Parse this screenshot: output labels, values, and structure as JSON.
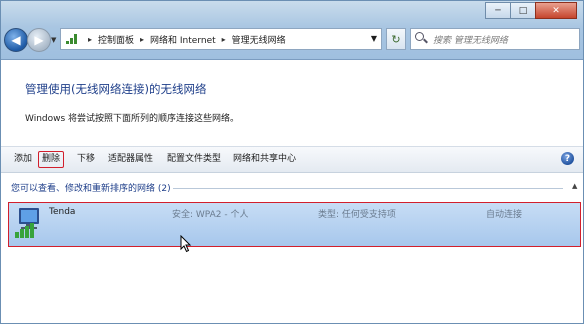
{
  "window": {
    "caption_minimize": "─",
    "caption_maximize": "□",
    "caption_close": "✕"
  },
  "nav": {
    "back_glyph": "◀",
    "forward_glyph": "▶",
    "refresh_glyph": "↻"
  },
  "address": {
    "breadcrumbs": [
      "控制面板",
      "网络和 Internet",
      "管理无线网络"
    ],
    "separator": "▸",
    "icon": "network-bars-icon"
  },
  "search": {
    "placeholder": "搜索 管理无线网络"
  },
  "page": {
    "title": "管理使用(无线网络连接)的无线网络",
    "description": "Windows 将尝试按照下面所列的顺序连接这些网络。"
  },
  "toolbar": {
    "add": "添加",
    "delete": "删除",
    "move_down": "下移",
    "adapter_properties": "适配器属性",
    "profile_type": "配置文件类型",
    "network_sharing_center": "网络和共享中心",
    "help": "?"
  },
  "group": {
    "label": "您可以查看、修改和重新排序的网络 (2)",
    "collapse_glyph": "▲"
  },
  "networks": [
    {
      "name": "Tenda",
      "security": "安全: WPA2 - 个人",
      "type": "类型: 任何受支持项",
      "mode": "自动连接"
    }
  ],
  "colors": {
    "accent": "#1f3f8a",
    "highlight_border": "#d21f2c",
    "row_selected": "#b3d0f0"
  }
}
